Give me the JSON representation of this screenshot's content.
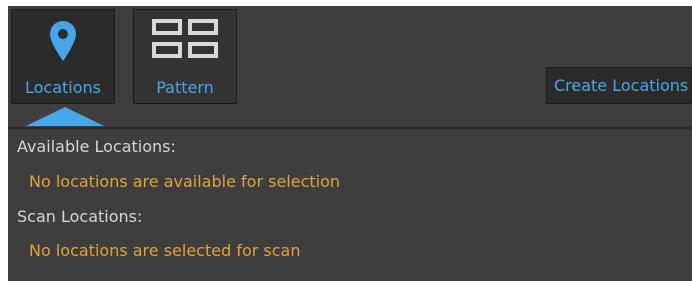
{
  "toolbar": {
    "locations": {
      "label": "Locations",
      "icon": "map-pin-icon",
      "selected": true
    },
    "pattern": {
      "label": "Pattern",
      "icon": "grid-pattern-icon"
    },
    "create_button": {
      "label": "Create Locations"
    }
  },
  "available": {
    "label": "Available Locations:",
    "message": "No locations are available for selection"
  },
  "scan": {
    "label": "Scan Locations:",
    "message": "No locations are selected for scan"
  },
  "colors": {
    "panel_background": "#3e3e3e",
    "button_background": "#2b2b2b",
    "accent_blue": "#47a6e8",
    "label_text": "#d6d6d6",
    "warning_text": "#e2a33a"
  }
}
